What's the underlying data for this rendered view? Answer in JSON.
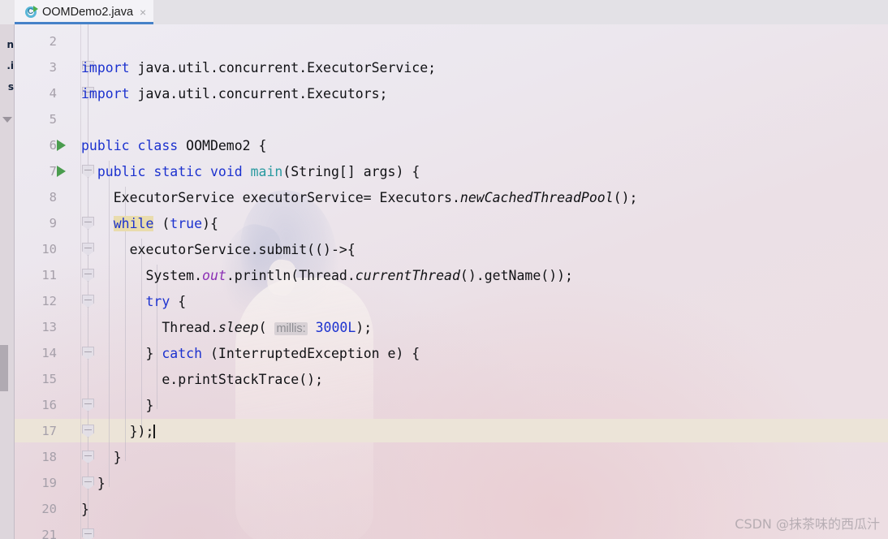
{
  "window": {
    "app": "intellij-idea-editor"
  },
  "project_panel": {
    "visible_fragments": [
      "n",
      ".i",
      "s"
    ],
    "caret_icon": "triangle-down-icon"
  },
  "tabbar": {
    "tabs": [
      {
        "label": "OOMDemo2.java",
        "icon": "java-class-with-main-icon",
        "close_icon": "×",
        "active": true
      }
    ],
    "active_underline_color": "#4682c8"
  },
  "editor": {
    "current_line": 17,
    "caret_line": 17,
    "first_visible_line": 2,
    "last_visible_line": 21,
    "line_numbers": [
      2,
      3,
      4,
      5,
      6,
      7,
      8,
      9,
      10,
      11,
      12,
      13,
      14,
      15,
      16,
      17,
      18,
      19,
      20,
      21
    ],
    "run_gutter_lines": [
      6,
      7
    ],
    "fold_marker_lines": [
      3,
      4,
      7,
      9,
      10,
      11,
      12,
      14,
      16,
      17,
      18,
      19,
      21
    ],
    "highlighted_token": "while",
    "highlight_color": "#e9dcad",
    "current_line_color": "#ece4d8",
    "keyword_color": "#1c32cf",
    "static_field_color": "#8b2fb5",
    "method_decl_color": "#2a9aa0",
    "lines": [
      {
        "n": 2,
        "tokens": []
      },
      {
        "n": 3,
        "tokens": [
          {
            "t": "import ",
            "c": "kw"
          },
          {
            "t": "java.util.concurrent.ExecutorService;",
            "c": "ident"
          }
        ]
      },
      {
        "n": 4,
        "tokens": [
          {
            "t": "import ",
            "c": "kw"
          },
          {
            "t": "java.util.concurrent.Executors;",
            "c": "ident"
          }
        ]
      },
      {
        "n": 5,
        "tokens": []
      },
      {
        "n": 6,
        "tokens": [
          {
            "t": "public class ",
            "c": "kw"
          },
          {
            "t": "OOMDemo2 {",
            "c": "ident"
          }
        ]
      },
      {
        "n": 7,
        "tokens": [
          {
            "t": "  ",
            "c": "ident"
          },
          {
            "t": "public static void ",
            "c": "kw"
          },
          {
            "t": "main",
            "c": "meth"
          },
          {
            "t": "(String[] args) {",
            "c": "ident"
          }
        ]
      },
      {
        "n": 8,
        "tokens": [
          {
            "t": "    ExecutorService executorService= Executors.",
            "c": "ident"
          },
          {
            "t": "newCachedThreadPool",
            "c": "ital"
          },
          {
            "t": "();",
            "c": "ident"
          }
        ]
      },
      {
        "n": 9,
        "tokens": [
          {
            "t": "    ",
            "c": "ident"
          },
          {
            "t": "while",
            "c": "kw-hl"
          },
          {
            "t": " (",
            "c": "ident"
          },
          {
            "t": "true",
            "c": "kw"
          },
          {
            "t": "){",
            "c": "ident"
          }
        ]
      },
      {
        "n": 10,
        "tokens": [
          {
            "t": "      executorService.submit(()->{",
            "c": "ident"
          }
        ]
      },
      {
        "n": 11,
        "tokens": [
          {
            "t": "        System.",
            "c": "ident"
          },
          {
            "t": "out",
            "c": "static-f"
          },
          {
            "t": ".println(Thread.",
            "c": "ident"
          },
          {
            "t": "currentThread",
            "c": "ital"
          },
          {
            "t": "().getName());",
            "c": "ident"
          }
        ]
      },
      {
        "n": 12,
        "tokens": [
          {
            "t": "        ",
            "c": "ident"
          },
          {
            "t": "try",
            "c": "kw"
          },
          {
            "t": " {",
            "c": "ident"
          }
        ]
      },
      {
        "n": 13,
        "tokens": [
          {
            "t": "          Thread.",
            "c": "ident"
          },
          {
            "t": "sleep",
            "c": "ital"
          },
          {
            "t": "( ",
            "c": "ident"
          },
          {
            "t": "millis:",
            "c": "param-hint"
          },
          {
            "t": " ",
            "c": "ident"
          },
          {
            "t": "3000L",
            "c": "num"
          },
          {
            "t": ");",
            "c": "ident"
          }
        ]
      },
      {
        "n": 14,
        "tokens": [
          {
            "t": "        } ",
            "c": "ident"
          },
          {
            "t": "catch",
            "c": "kw"
          },
          {
            "t": " (InterruptedException e) {",
            "c": "ident"
          }
        ]
      },
      {
        "n": 15,
        "tokens": [
          {
            "t": "          e.printStackTrace();",
            "c": "ident"
          }
        ]
      },
      {
        "n": 16,
        "tokens": [
          {
            "t": "        }",
            "c": "ident"
          }
        ]
      },
      {
        "n": 17,
        "tokens": [
          {
            "t": "      });",
            "c": "ident"
          },
          {
            "t": "",
            "c": "caret"
          }
        ]
      },
      {
        "n": 18,
        "tokens": [
          {
            "t": "    }",
            "c": "ident"
          }
        ]
      },
      {
        "n": 19,
        "tokens": [
          {
            "t": "  }",
            "c": "ident"
          }
        ]
      },
      {
        "n": 20,
        "tokens": [
          {
            "t": "}",
            "c": "ident"
          }
        ]
      },
      {
        "n": 21,
        "tokens": []
      }
    ]
  },
  "watermark": {
    "text": "CSDN @抹茶味的西瓜汁"
  }
}
